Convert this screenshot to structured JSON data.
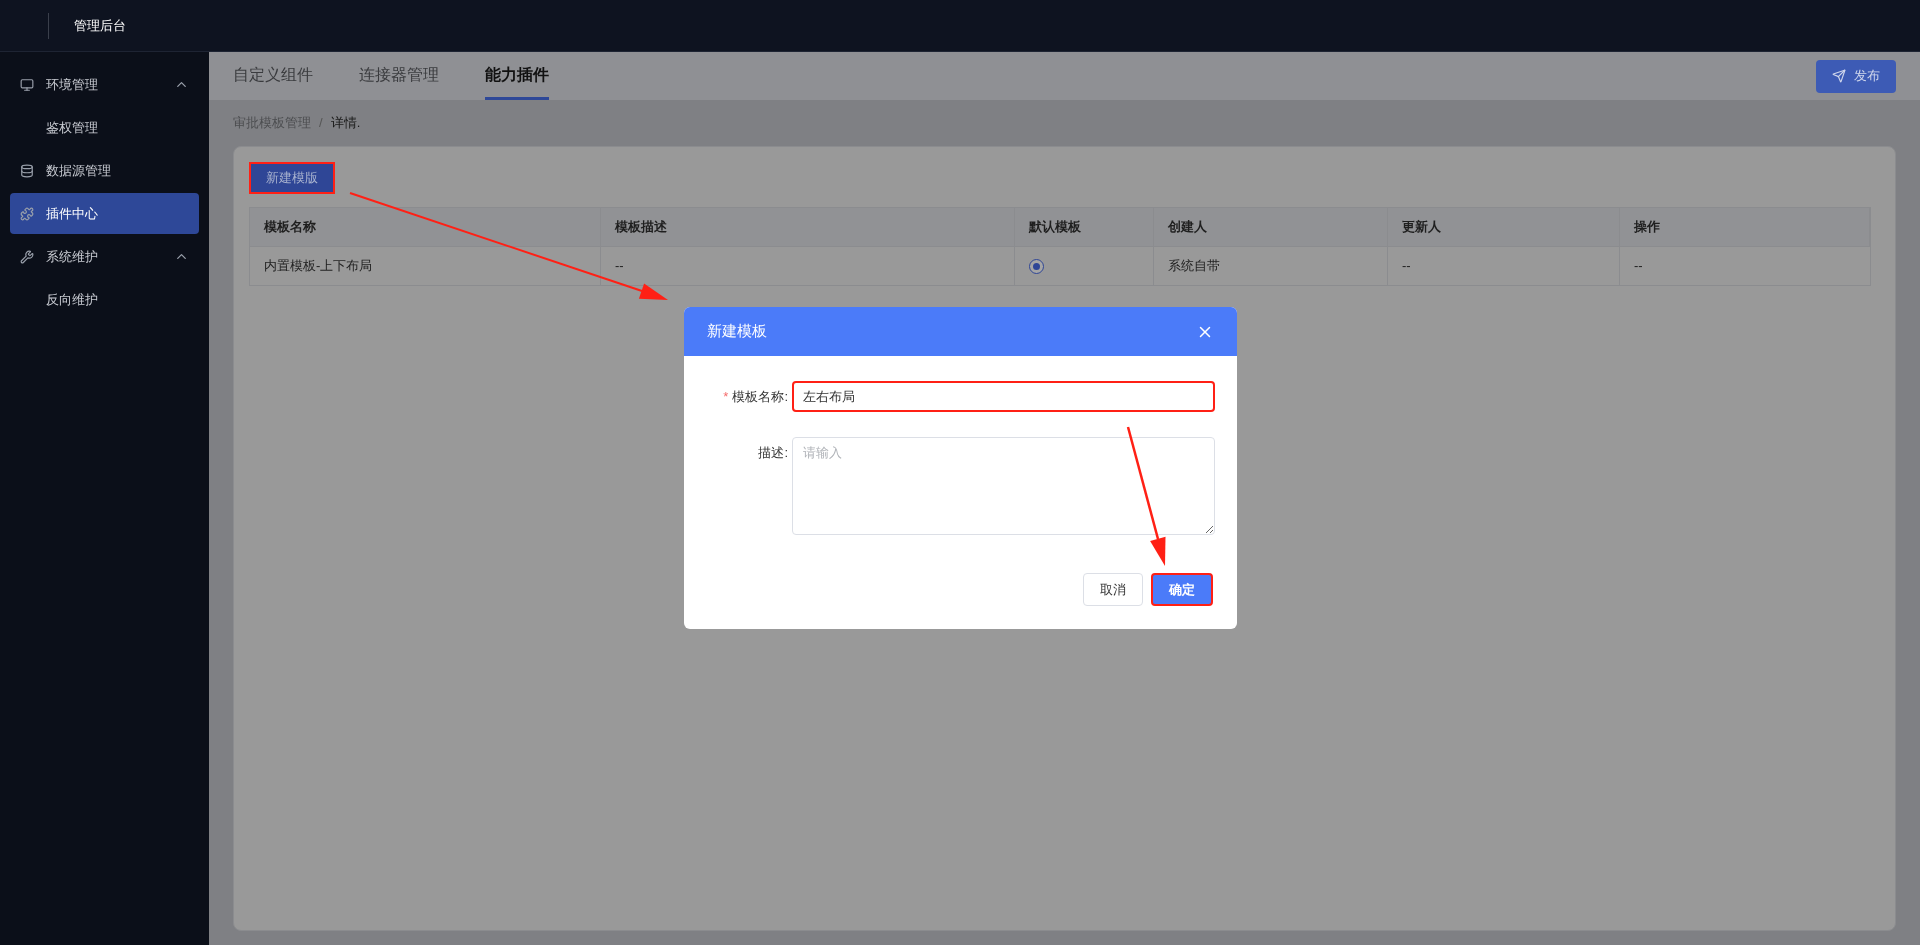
{
  "header": {
    "title": "管理后台"
  },
  "sidebar": {
    "items": [
      {
        "label": "环境管理",
        "selected": false,
        "expanded": true,
        "children": [
          {
            "label": "鉴权管理",
            "selected": false
          }
        ]
      },
      {
        "label": "数据源管理",
        "selected": false
      },
      {
        "label": "插件中心",
        "selected": true
      },
      {
        "label": "系统维护",
        "selected": false,
        "expanded": true,
        "children": [
          {
            "label": "反向维护",
            "selected": false
          }
        ]
      }
    ]
  },
  "tabs": [
    {
      "label": "自定义组件",
      "selected": false
    },
    {
      "label": "连接器管理",
      "selected": false
    },
    {
      "label": "能力插件",
      "selected": true
    }
  ],
  "publish_button": {
    "label": "发布"
  },
  "breadcrumb": {
    "separator": "/",
    "items": [
      {
        "label": "审批模板管理"
      },
      {
        "label": "详情."
      }
    ]
  },
  "new_button": {
    "label": "新建模版",
    "annotated": true
  },
  "table": {
    "columns": [
      "模板名称",
      "模板描述",
      "默认模板",
      "创建人",
      "更新人",
      "操作"
    ],
    "rows": [
      {
        "name": "内置模板-上下布局",
        "description": "--",
        "default": {
          "selected": true
        },
        "creator": "系统自带",
        "updater": "--",
        "actions": "--"
      }
    ]
  },
  "dialog": {
    "title": "新建模板",
    "fields": [
      {
        "kind": "input",
        "label": "模板名称:",
        "required_mark": "*",
        "value": "左右布局",
        "annotated": true
      },
      {
        "kind": "textarea",
        "label": "描述:",
        "placeholder": "请输入",
        "annotated": false
      }
    ],
    "buttons": [
      {
        "label": "取消",
        "primary": false,
        "annotated": false
      },
      {
        "label": "确定",
        "primary": true,
        "annotated": true
      }
    ]
  }
}
